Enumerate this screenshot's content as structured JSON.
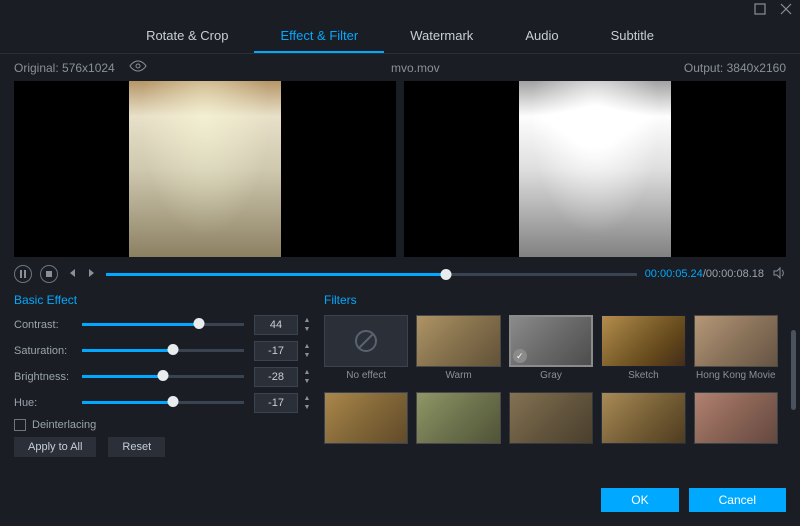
{
  "tabs": [
    "Rotate & Crop",
    "Effect & Filter",
    "Watermark",
    "Audio",
    "Subtitle"
  ],
  "active_tab": 1,
  "info": {
    "original": "Original: 576x1024",
    "filename": "mvo.mov",
    "output": "Output: 3840x2160"
  },
  "playback": {
    "current": "00:00:05.24",
    "sep": "/",
    "total": "00:00:08.18",
    "progress_pct": 64
  },
  "basic": {
    "title": "Basic Effect",
    "rows": [
      {
        "label": "Contrast:",
        "value": "44",
        "pct": 72
      },
      {
        "label": "Saturation:",
        "value": "-17",
        "pct": 56
      },
      {
        "label": "Brightness:",
        "value": "-28",
        "pct": 50
      },
      {
        "label": "Hue:",
        "value": "-17",
        "pct": 56
      }
    ],
    "deinterlacing": "Deinterlacing",
    "apply_all": "Apply to All",
    "reset": "Reset"
  },
  "filters": {
    "title": "Filters",
    "items": [
      "No effect",
      "Warm",
      "Gray",
      "Sketch",
      "Hong Kong Movie"
    ],
    "selected": 2
  },
  "footer": {
    "ok": "OK",
    "cancel": "Cancel"
  }
}
